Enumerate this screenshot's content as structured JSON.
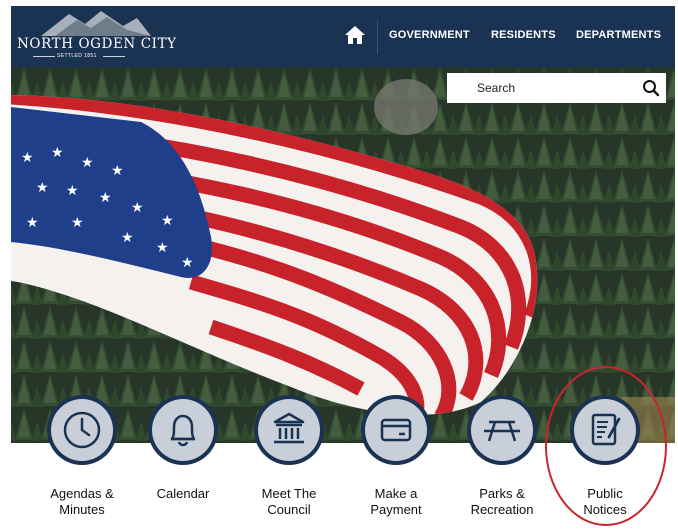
{
  "header": {
    "logo_name": "North Ogden City",
    "logo_settled": "SETTLED 1851",
    "nav": [
      "GOVERNMENT",
      "RESIDENTS",
      "DEPARTMENTS"
    ]
  },
  "search": {
    "placeholder": "Search"
  },
  "quick_links": [
    {
      "label": "Agendas &\nMinutes",
      "icon": "clock-icon"
    },
    {
      "label": "Calendar",
      "icon": "bell-icon"
    },
    {
      "label": "Meet The\nCouncil",
      "icon": "building-icon"
    },
    {
      "label": "Make a\nPayment",
      "icon": "card-icon"
    },
    {
      "label": "Parks &\nRecreation",
      "icon": "picnic-table-icon"
    },
    {
      "label": "Public\nNotices",
      "icon": "notice-icon"
    }
  ],
  "colors": {
    "navy": "#1b3352",
    "icon_bg": "#c9cfd8",
    "annotation_red": "#c8262c"
  }
}
